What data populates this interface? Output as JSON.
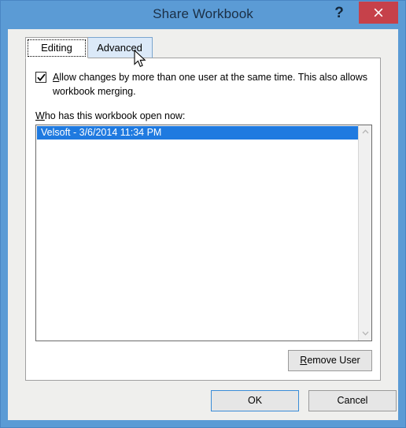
{
  "window": {
    "title": "Share Workbook",
    "help_label": "?",
    "close_icon": "close-x-icon",
    "accent_titlebar": "#5b9bd5",
    "accent_close": "#c6414a"
  },
  "tabs": [
    {
      "label": "Editing",
      "state": "active"
    },
    {
      "label": "Advanced",
      "state": "hover"
    }
  ],
  "editing_tab": {
    "allow_changes_checkbox": {
      "checked": true,
      "accelerator": "A",
      "label_rest": "llow changes by more than one user at the same time.  This also allows workbook merging."
    },
    "list_label": {
      "accelerator": "W",
      "rest": "ho has this workbook open now:"
    },
    "user_list": [
      "Velsoft - 3/6/2014 11:34 PM"
    ],
    "selection_color": "#1f7ae0",
    "remove_user_button": {
      "accelerator": "R",
      "rest": "emove User"
    },
    "scrollbar": {
      "up_icon": "chevron-up-icon",
      "down_icon": "chevron-down-icon"
    }
  },
  "footer": {
    "ok_label": "OK",
    "cancel_label": "Cancel"
  },
  "pointer": {
    "icon": "mouse-arrow-cursor"
  }
}
